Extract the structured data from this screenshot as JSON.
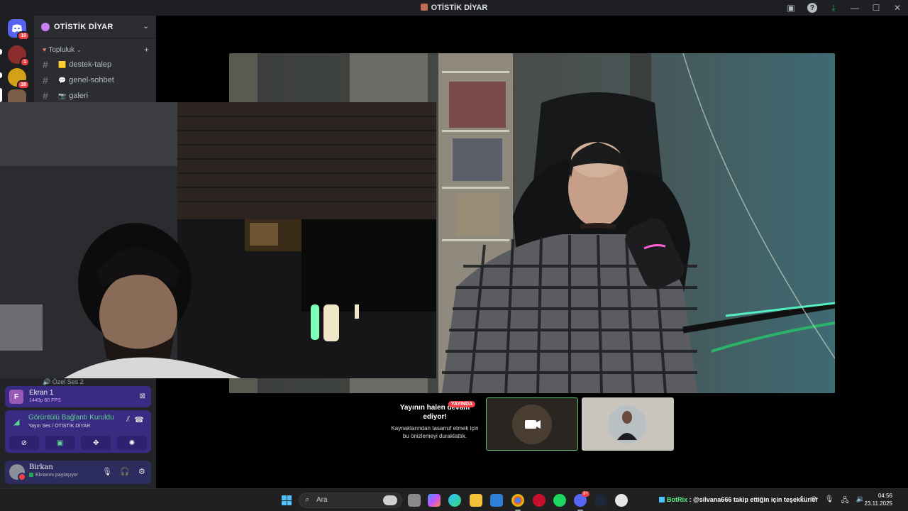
{
  "window": {
    "title": "OTİSTİK DİYAR"
  },
  "rail": {
    "home_badge": "10",
    "servers": [
      {
        "badge": "1"
      },
      {
        "badge": "38"
      },
      {
        "badge": ""
      }
    ]
  },
  "server": {
    "name": "OTİSTİK DİYAR",
    "category": "Topluluk",
    "channels": [
      {
        "name": "destek-talep",
        "emoji": "🟨"
      },
      {
        "name": "genel-sohbet",
        "emoji": "💬"
      },
      {
        "name": "galeri",
        "emoji": "📷"
      }
    ],
    "peek_channel": "Özel Ses 2"
  },
  "stream_pause": {
    "live_badge": "YAYINDA",
    "headline": "Yayının halen devam ediyor!",
    "subtext": "Kaynaklarından tasarruf etmek için bu önizlemeyi duraklattık."
  },
  "screen_share": {
    "title": "Ekran 1",
    "quality": "1440p 60 FPS",
    "avatar_letter": "F"
  },
  "voice": {
    "status": "Görüntülü Bağlantı Kuruldu",
    "channel": "Yayın Ses / OTİSTİK DİYAR"
  },
  "user": {
    "name": "Birkan",
    "status": "Ekranını paylaşıyor"
  },
  "taskbar": {
    "search_label": "Ara",
    "discord_badge": "9+",
    "ticker_bot": "BotRix",
    "ticker_text": ": @silvana666 takip ettiğin için teşekkürler",
    "time": "04:56",
    "date": "23.11.2025"
  },
  "colors": {
    "accent": "#5865f2",
    "danger": "#f23f43",
    "online": "#23a55a",
    "panel_purple": "#3a2b82"
  },
  "icons": [
    "discord-home-icon",
    "hash-icon",
    "plus-icon",
    "chevron-down-icon",
    "camera-icon",
    "mic-icon",
    "headphones-icon",
    "gear-icon",
    "signal-icon",
    "hangup-icon",
    "windows-icon",
    "search-icon"
  ]
}
